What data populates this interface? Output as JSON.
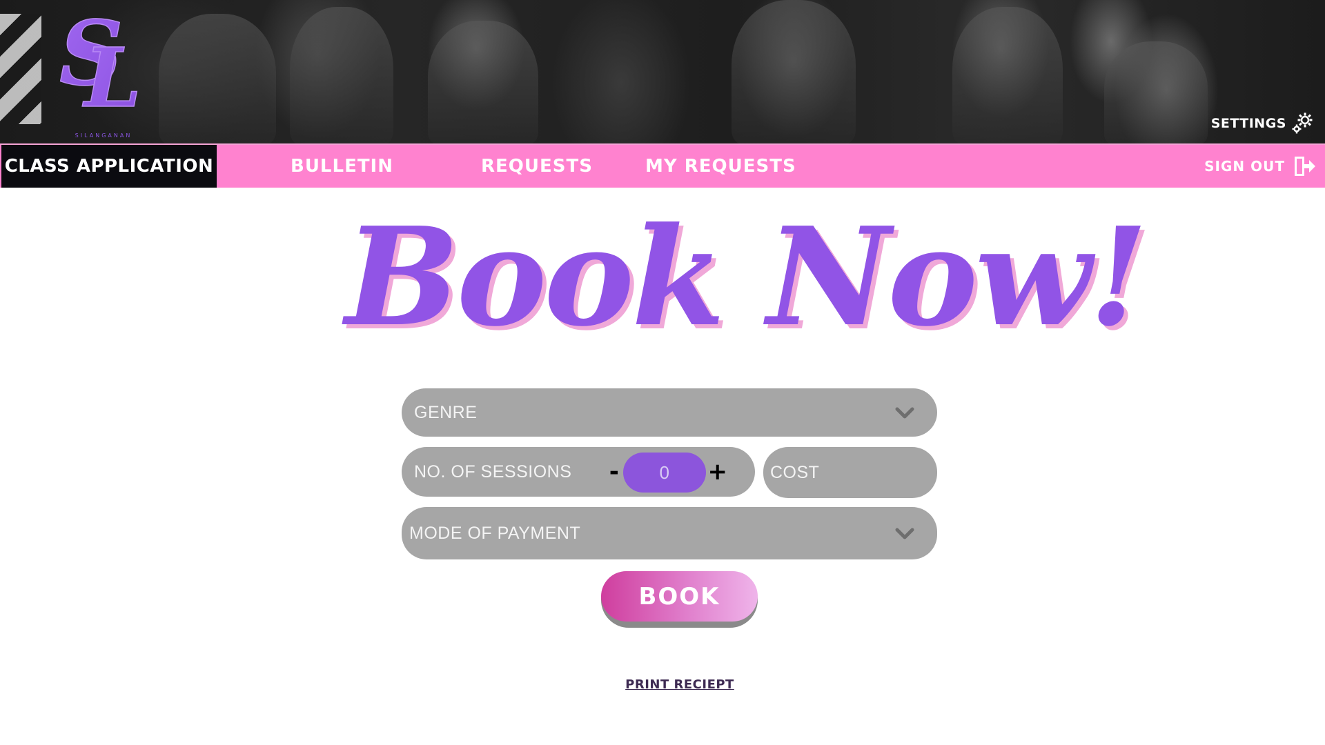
{
  "app": {
    "logo_text": "SL",
    "logo_subtext": "SILANGANAN"
  },
  "header": {
    "settings_label": "SETTINGS",
    "settings_icon": "gear-icon"
  },
  "nav": {
    "items": [
      {
        "label": "CLASS APPLICATION",
        "active": true
      },
      {
        "label": "BULLETIN",
        "active": false
      },
      {
        "label": "REQUESTS",
        "active": false
      },
      {
        "label": "MY REQUESTS",
        "active": false
      }
    ],
    "signout_label": "SIGN OUT",
    "signout_icon": "sign-out-icon"
  },
  "main": {
    "headline": "Book Now!",
    "form": {
      "genre_placeholder": "GENRE",
      "sessions_label": "NO. OF SESSIONS",
      "sessions_minus": "-",
      "sessions_value": "0",
      "sessions_plus": "+",
      "cost_placeholder": "COST",
      "payment_placeholder": "MODE OF PAYMENT",
      "book_label": "BOOK"
    },
    "print_link": "PRINT RECIEPT"
  },
  "colors": {
    "accent_purple": "#9154e6",
    "nav_pink": "#ff82cf",
    "active_tab": "#0b0b10",
    "field_gray": "#a6a6a6",
    "book_gradient_start": "#cf3e9e",
    "book_gradient_end": "#efb4ea",
    "headline_shadow": "#f0a8d8"
  }
}
